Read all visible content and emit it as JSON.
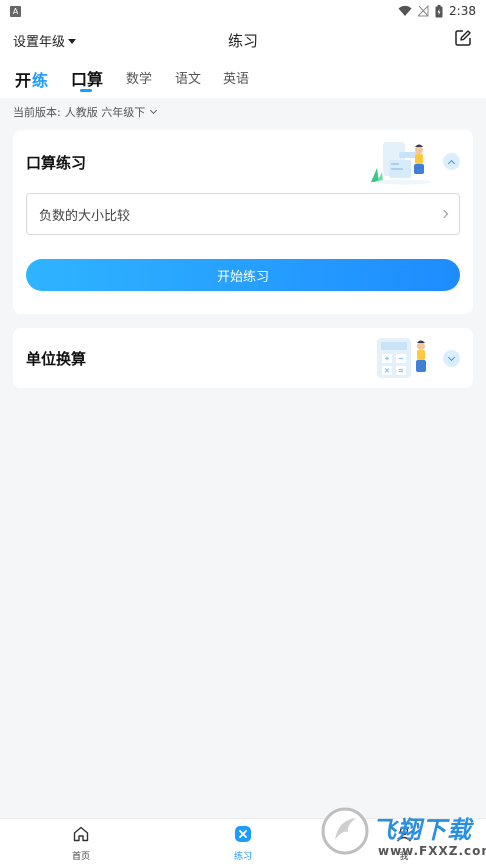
{
  "status_bar": {
    "badge": "A",
    "time": "2:38"
  },
  "header": {
    "grade_select": "设置年级",
    "title": "练习"
  },
  "tabs": {
    "brand": "开练",
    "items": [
      {
        "label": "口算",
        "active": true
      },
      {
        "label": "数学",
        "active": false
      },
      {
        "label": "语文",
        "active": false
      },
      {
        "label": "英语",
        "active": false
      }
    ]
  },
  "version": {
    "label": "当前版本:",
    "value": "人教版 六年级下"
  },
  "cards": [
    {
      "title": "口算练习",
      "expanded": true,
      "topic": "负数的大小比较",
      "button": "开始练习"
    },
    {
      "title": "单位换算",
      "expanded": false
    }
  ],
  "bottom_nav": [
    {
      "label": "首页",
      "icon": "home-icon",
      "active": false
    },
    {
      "label": "练习",
      "icon": "practice-icon",
      "active": true
    },
    {
      "label": "我",
      "icon": "profile-icon",
      "active": false
    }
  ],
  "watermark": {
    "text": "飞翔下载",
    "url": "www.FXXZ.com"
  },
  "colors": {
    "accent": "#1e9bff",
    "background": "#f5f6f8"
  }
}
